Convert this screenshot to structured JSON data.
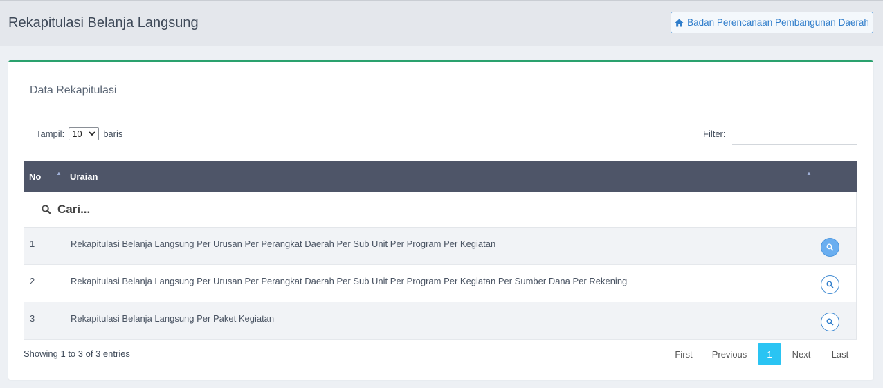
{
  "header": {
    "title": "Rekapitulasi Belanja Langsung",
    "button_label": "Badan Perencanaan Pembangunan Daerah",
    "button_icon": "home-icon"
  },
  "card": {
    "title": "Data Rekapitulasi",
    "length": {
      "prefix": "Tampil:",
      "value": "10",
      "suffix": "baris"
    },
    "filter": {
      "label": "Filter:",
      "value": ""
    }
  },
  "table": {
    "columns": {
      "no": "No",
      "uraian": "Uraian"
    },
    "search_placeholder": "Cari...",
    "rows": [
      {
        "no": "1",
        "uraian": "Rekapitulasi Belanja Langsung Per Urusan Per Perangkat Daerah Per Sub Unit Per Program Per Kegiatan"
      },
      {
        "no": "2",
        "uraian": "Rekapitulasi Belanja Langsung Per Urusan Per Perangkat Daerah Per Sub Unit Per Program Per Kegiatan Per Sumber Dana Per Rekening"
      },
      {
        "no": "3",
        "uraian": "Rekapitulasi Belanja Langsung Per Paket Kegiatan"
      }
    ]
  },
  "footer": {
    "info": "Showing 1 to 3 of 3 entries",
    "pagination": {
      "first": "First",
      "previous": "Previous",
      "current": "1",
      "next": "Next",
      "last": "Last"
    }
  },
  "colors": {
    "table_header": "#4e5568",
    "accent_green": "#2aa16e",
    "link_blue": "#3f8ad2",
    "active_page": "#2ac4f3"
  }
}
